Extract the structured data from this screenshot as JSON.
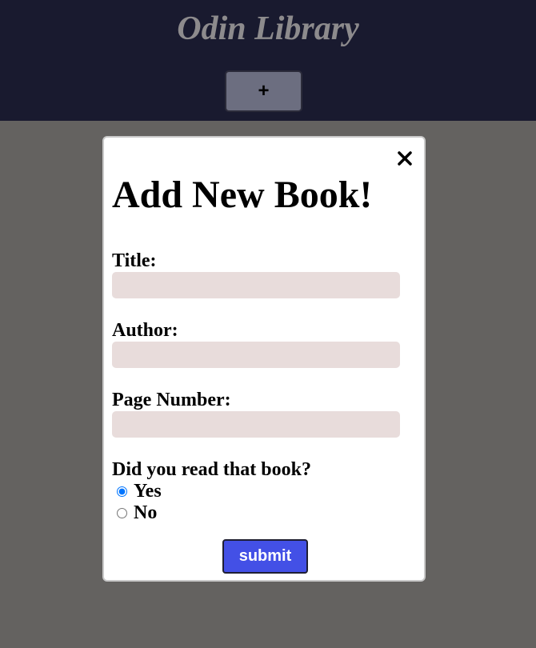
{
  "header": {
    "title": "Odin Library",
    "add_button_label": "+"
  },
  "modal": {
    "close_icon": "close-icon",
    "title": "Add New Book!",
    "fields": [
      {
        "label": "Title:",
        "value": "",
        "placeholder": ""
      },
      {
        "label": "Author:",
        "value": "",
        "placeholder": ""
      },
      {
        "label": "Page Number:",
        "value": "",
        "placeholder": ""
      }
    ],
    "read_question": "Did you read that book?",
    "read_options": [
      {
        "label": "Yes",
        "checked": true
      },
      {
        "label": "No",
        "checked": false
      }
    ],
    "submit_label": "submit"
  },
  "colors": {
    "header_bg": "#191a2f",
    "overlay_bg": "#646260",
    "input_bg": "#e8dcdb",
    "submit_bg": "#4350e6",
    "title_color": "#8d8b8d"
  }
}
